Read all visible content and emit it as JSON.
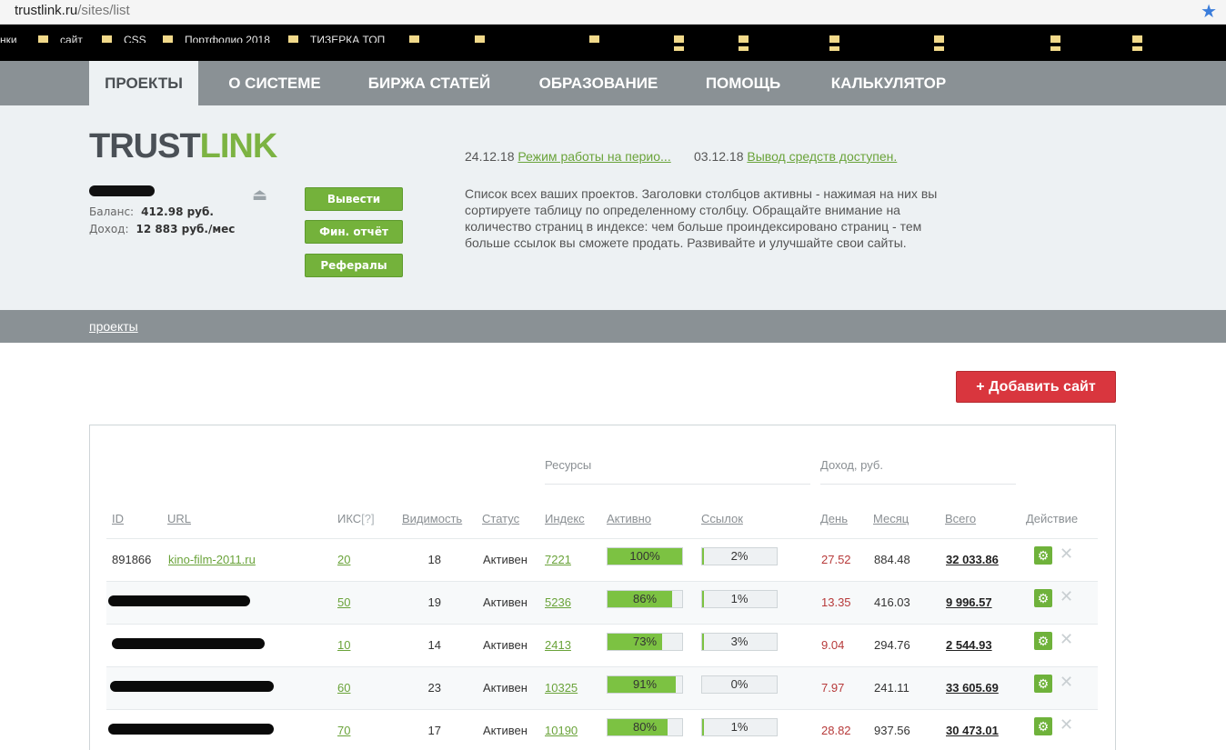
{
  "browser": {
    "url_host": "trustlink.ru",
    "url_path": "/sites/list"
  },
  "bookmarks": [
    "нки",
    "сайт",
    "CSS",
    "Портфолио 2018",
    "ТИЗЕРКА ТОП"
  ],
  "nav": {
    "tabs": [
      {
        "label": "ПРОЕКТЫ",
        "active": true
      },
      {
        "label": "О СИСТЕМЕ",
        "active": false
      },
      {
        "label": "БИРЖА СТАТЕЙ",
        "active": false
      },
      {
        "label": "ОБРАЗОВАНИЕ",
        "active": false
      },
      {
        "label": "ПОМОЩЬ",
        "active": false
      },
      {
        "label": "КАЛЬКУЛЯТОР",
        "active": false
      }
    ]
  },
  "logo": {
    "part1": "TRUST",
    "part2": "LINK"
  },
  "account": {
    "balance_label": "Баланс:",
    "balance_value": "412.98  руб.",
    "income_label": "Доход:",
    "income_value": "12 883 руб./мес"
  },
  "buttons": {
    "withdraw": "Вывести",
    "fin_report": "Фин. отчёт",
    "referrals": "Рефералы",
    "add_site": "+ Добавить сайт"
  },
  "news": [
    {
      "date": "24.12.18",
      "text": "Режим работы на перио..."
    },
    {
      "date": "03.12.18",
      "text": "Вывод средств доступен."
    }
  ],
  "description": "Список всех ваших проектов. Заголовки столбцов активны - нажимая на них вы сортируете таблицу по определенному столбцу. Обращайте внимание на количество страниц в индексе: чем больше проиндексировано страниц - тем больше ссылок вы сможете продать. Развивайте и улучшайте свои сайты.",
  "breadcrumb": "проекты",
  "table": {
    "groups": {
      "resources": "Ресурсы",
      "income": "Доход,  руб."
    },
    "headers": {
      "id": "ID",
      "url": "URL",
      "iks": "ИКС",
      "iks_help": "[?]",
      "visibility": "Видимость",
      "status": "Статус",
      "index": "Индекс",
      "active": "Активно",
      "links": "Ссылок",
      "day": "День",
      "month": "Месяц",
      "total": "Всего",
      "action": "Действие"
    },
    "rows": [
      {
        "id": "891866",
        "url": "kino-film-2011.ru",
        "iks": "20",
        "visibility": "18",
        "status": "Активен",
        "index": "7221",
        "active": "100%",
        "active_pct": 100,
        "links": "2%",
        "links_pct": 2,
        "day": "27.52",
        "month": "884.48",
        "total": "32 033.86"
      },
      {
        "id": "",
        "url": "",
        "iks": "50",
        "visibility": "19",
        "status": "Активен",
        "index": "5236",
        "active": "86%",
        "active_pct": 86,
        "links": "1%",
        "links_pct": 1,
        "day": "13.35",
        "month": "416.03",
        "total": "9 996.57"
      },
      {
        "id": "",
        "url": "",
        "iks": "10",
        "visibility": "14",
        "status": "Активен",
        "index": "2413",
        "active": "73%",
        "active_pct": 73,
        "links": "3%",
        "links_pct": 3,
        "day": "9.04",
        "month": "294.76",
        "total": "2 544.93"
      },
      {
        "id": "",
        "url": "",
        "iks": "60",
        "visibility": "23",
        "status": "Активен",
        "index": "10325",
        "active": "91%",
        "active_pct": 91,
        "links": "0%",
        "links_pct": 0,
        "day": "7.97",
        "month": "241.11",
        "total": "33 605.69"
      },
      {
        "id": "",
        "url": "",
        "iks": "70",
        "visibility": "17",
        "status": "Активен",
        "index": "10190",
        "active": "80%",
        "active_pct": 80,
        "links": "1%",
        "links_pct": 1,
        "day": "28.82",
        "month": "937.56",
        "total": "30 473.01"
      }
    ]
  },
  "colors": {
    "accent_green": "#74b23b",
    "add_red": "#d9363e",
    "nav_gray": "#8a9195",
    "day_red": "#b73a3a"
  }
}
